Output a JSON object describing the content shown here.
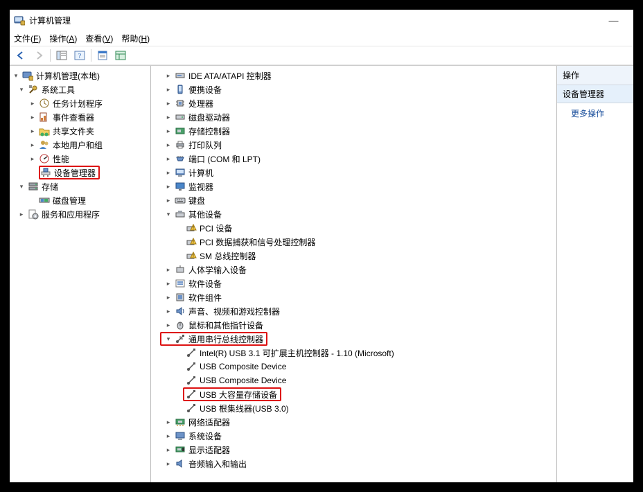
{
  "window": {
    "title": "计算机管理",
    "minimize_glyph": "—"
  },
  "menu": {
    "file": "文件",
    "file_m": "F",
    "action": "操作",
    "action_m": "A",
    "view": "查看",
    "view_m": "V",
    "help": "帮助",
    "help_m": "H"
  },
  "left": {
    "root": "计算机管理(本地)",
    "system_tools": "系统工具",
    "task_scheduler": "任务计划程序",
    "event_viewer": "事件查看器",
    "shared_folders": "共享文件夹",
    "local_users": "本地用户和组",
    "performance": "性能",
    "device_manager": "设备管理器",
    "storage": "存储",
    "disk_mgmt": "磁盘管理",
    "services_apps": "服务和应用程序"
  },
  "mid": {
    "ide": "IDE ATA/ATAPI 控制器",
    "portable": "便携设备",
    "cpu": "处理器",
    "diskdrives": "磁盘驱动器",
    "storagectrl": "存储控制器",
    "printq": "打印队列",
    "ports": "端口 (COM 和 LPT)",
    "computer": "计算机",
    "monitor": "监视器",
    "keyboard": "键盘",
    "other": "其他设备",
    "other_pci": "PCI 设备",
    "other_pci_sig": "PCI 数据捕获和信号处理控制器",
    "other_sm": "SM 总线控制器",
    "hid": "人体学输入设备",
    "sw_dev": "软件设备",
    "sw_comp": "软件组件",
    "sound": "声音、视频和游戏控制器",
    "mouse": "鼠标和其他指针设备",
    "usb_ctrl": "通用串行总线控制器",
    "usb_intel": "Intel(R) USB 3.1 可扩展主机控制器 - 1.10 (Microsoft)",
    "usb_comp1": "USB Composite Device",
    "usb_comp2": "USB Composite Device",
    "usb_mass": "USB 大容量存储设备",
    "usb_roothub": "USB 根集线器(USB 3.0)",
    "net": "网络适配器",
    "sysdev": "系统设备",
    "display": "显示适配器",
    "audio_io": "音频输入和输出"
  },
  "right": {
    "header": "操作",
    "selected": "设备管理器",
    "more": "更多操作"
  }
}
